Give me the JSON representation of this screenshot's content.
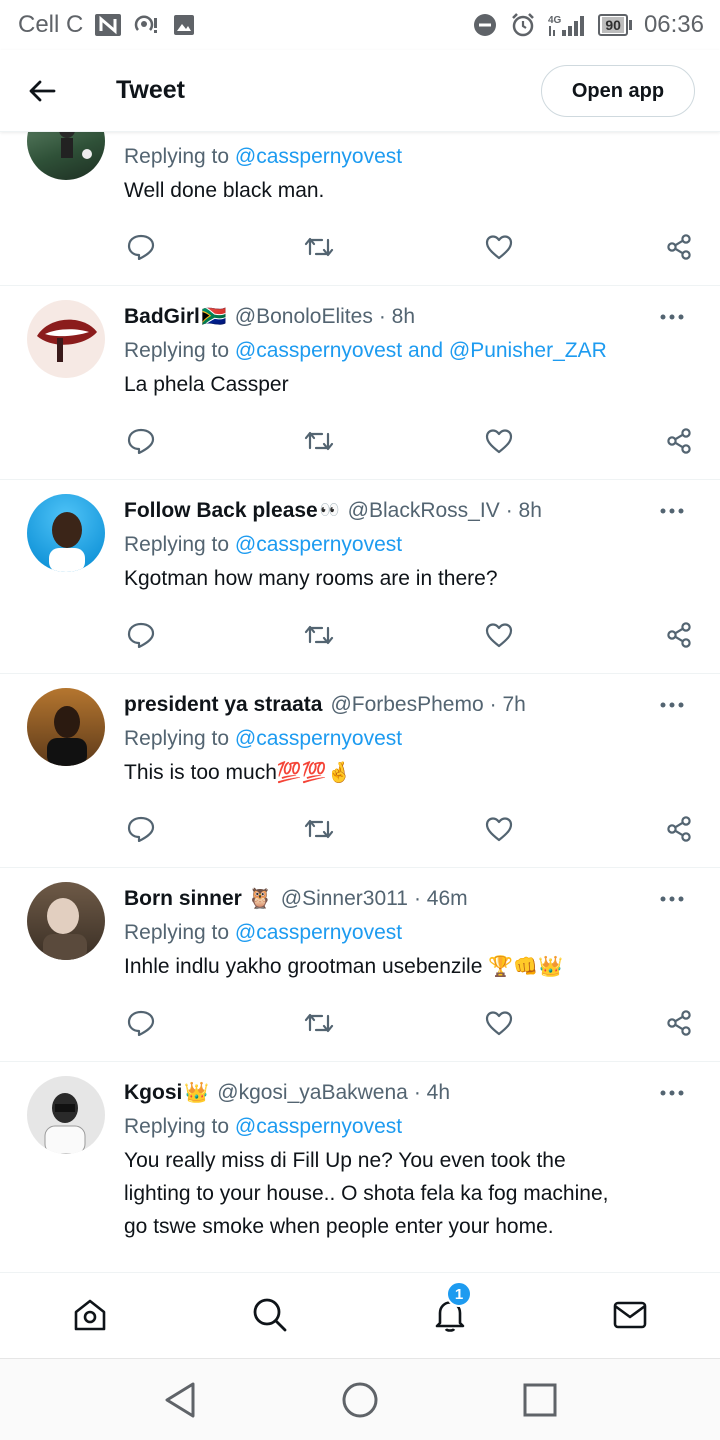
{
  "status_bar": {
    "carrier": "Cell C",
    "network": "4G",
    "battery": "90",
    "time": "06:36"
  },
  "header": {
    "title": "Tweet",
    "open_app_label": "Open app"
  },
  "replying_prefix": "Replying to",
  "tweets": [
    {
      "name": "",
      "handle": "",
      "time": "",
      "reply_to": "@casspernyovest",
      "reply_and": "",
      "reply_to2": "",
      "text": "Well done black man.",
      "avatar_color": "#3e6b4a"
    },
    {
      "name": "BadGirl",
      "name_emoji": "🇿🇦",
      "handle": "@BonoloElites",
      "time": "· 8h",
      "reply_to": "@casspernyovest",
      "reply_and": "and",
      "reply_to2": "@Punisher_ZAR",
      "text": "La phela Cassper",
      "avatar_color": "#c62828"
    },
    {
      "name": "Follow Back please",
      "name_emoji": "👀",
      "handle": "@BlackRoss_IV",
      "time": "· 8h",
      "reply_to": "@casspernyovest",
      "text": "Kgotman how many rooms are in there?",
      "avatar_color": "#29b6f6"
    },
    {
      "name": "president ya straata",
      "handle": "@ForbesPhemo",
      "time": "· 7h",
      "reply_to": "@casspernyovest",
      "text": "This is too much",
      "text_emoji": "💯💯🤞",
      "avatar_color": "#6d4c2b"
    },
    {
      "name": "Born sinner",
      "name_emoji": "🦉",
      "handle": "@Sinner3011",
      "time": "· 46m",
      "reply_to": "@casspernyovest",
      "text": "Inhle indlu yakho grootman usebenzile",
      "text_emoji": "🏆👊👑",
      "avatar_color": "#8d7b6a"
    },
    {
      "name": "Kgosi",
      "name_emoji": "👑",
      "handle": "@kgosi_yaBakwena",
      "time": "· 4h",
      "reply_to": "@casspernyovest",
      "text_lines": [
        "You really miss di Fill Up ne? You even took the",
        "lighting to your house.. O shota fela ka fog machine,",
        "go tswe smoke when people enter your home."
      ],
      "avatar_color": "#bdbdbd"
    }
  ],
  "bottom_nav": {
    "notification_count": "1"
  },
  "icons": {
    "status_left": [
      "n-icon",
      "signal-hotspot-icon",
      "image-icon"
    ],
    "status_right": [
      "dnd-icon",
      "alarm-icon",
      "signal-icon",
      "battery-icon"
    ],
    "tweet_actions": [
      "reply-icon",
      "retweet-icon",
      "like-icon",
      "share-icon"
    ],
    "bottom_nav": [
      "home-icon",
      "search-icon",
      "notifications-icon",
      "messages-icon"
    ],
    "system_nav": [
      "back-triangle-icon",
      "home-circle-icon",
      "recents-square-icon"
    ]
  },
  "colors": {
    "link": "#1d9bf0",
    "secondary_text": "#536471",
    "primary_text": "#0f1419"
  }
}
